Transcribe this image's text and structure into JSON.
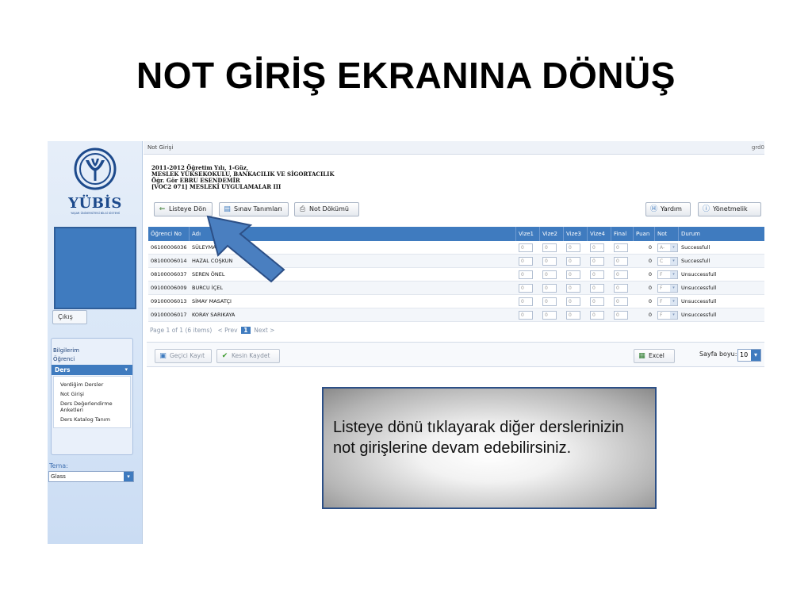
{
  "slide": {
    "title": "NOT GİRİŞ EKRANINA DÖNÜŞ"
  },
  "sidebar": {
    "logo_text": "YÜBİS",
    "logo_subtext": "YAŞAR ÜNİVERSİTESİ BİLGİ SİSTEMİ",
    "logout_label": "Çıkış",
    "menu": {
      "items_top": [
        "Bilgilerim",
        "Öğrenci"
      ],
      "active_label": "Ders",
      "sub_items": [
        "Verdiğim Dersler",
        "Not Girişi",
        "Ders Değerlendirme Anketleri",
        "Ders Katalog Tanım"
      ]
    },
    "theme_label": "Tema:",
    "theme_value": "Glass"
  },
  "topbar": {
    "title": "Not Girişi",
    "user": "grd0"
  },
  "info": {
    "line1": "2011-2012 Öğretim Yılı, 1-Güz,",
    "line2": "MESLEK YÜKSEKOKULU, BANKACILIK VE SİGORTACILIK",
    "line3": "Öğr. Gör EBRU ESENDEMİR",
    "line4": "[VOC2 071] MESLEKİ UYGULAMALAR III"
  },
  "toolbar": {
    "back_label": "Listeye Dön",
    "exam_label": "Sınav Tanımları",
    "print_label": "Not Dökümü",
    "help_label": "Yardım",
    "admin_label": "Yönetmelik"
  },
  "table": {
    "columns": [
      "Öğrenci No",
      "Adı",
      "Vize1",
      "Vize2",
      "Vize3",
      "Vize4",
      "Final",
      "Puan",
      "Not",
      "Durum"
    ],
    "rows": [
      {
        "no": "06100006036",
        "name": "SÜLEYMAN G",
        "v1": "0",
        "v2": "0",
        "v3": "0",
        "v4": "0",
        "final": "0",
        "puan": "0",
        "not": "A-",
        "durum": "Successfull"
      },
      {
        "no": "08100006014",
        "name": "HAZAL COŞKUN",
        "v1": "0",
        "v2": "0",
        "v3": "0",
        "v4": "0",
        "final": "0",
        "puan": "0",
        "not": "C",
        "durum": "Successfull"
      },
      {
        "no": "08100006037",
        "name": "SEREN ÖNEL",
        "v1": "0",
        "v2": "0",
        "v3": "0",
        "v4": "0",
        "final": "0",
        "puan": "0",
        "not": "F",
        "durum": "Unsuccessfull"
      },
      {
        "no": "09100006009",
        "name": "BURCU İÇEL",
        "v1": "0",
        "v2": "0",
        "v3": "0",
        "v4": "0",
        "final": "0",
        "puan": "0",
        "not": "F",
        "durum": "Unsuccessfull"
      },
      {
        "no": "09100006013",
        "name": "SİMAY MASATÇI",
        "v1": "0",
        "v2": "0",
        "v3": "0",
        "v4": "0",
        "final": "0",
        "puan": "0",
        "not": "F",
        "durum": "Unsuccessfull"
      },
      {
        "no": "09100006017",
        "name": "KORAY SARIKAYA",
        "v1": "0",
        "v2": "0",
        "v3": "0",
        "v4": "0",
        "final": "0",
        "puan": "0",
        "not": "F",
        "durum": "Unsuccessfull"
      }
    ]
  },
  "pager": {
    "text": "Page 1 of 1 (6 items)",
    "prev": "< Prev",
    "current": "1",
    "next": "Next >"
  },
  "bottom": {
    "temp_save_label": "Geçici Kayıt",
    "final_save_label": "Kesin Kaydet",
    "excel_label": "Excel",
    "page_size_label": "Sayfa boyu:",
    "page_size_value": "10"
  },
  "callout": {
    "text": "Listeye dönü tıklayarak diğer derslerinizin not girişlerine devam edebilirsiniz."
  },
  "colors": {
    "accent": "#3f7bbf",
    "arrow": "#4a7fc0",
    "callout_border": "#2c4f86"
  },
  "icons": {
    "back": "arrow-left-icon",
    "exam": "document-icon",
    "print": "printer-icon",
    "help": "help-icon",
    "info": "info-icon",
    "save": "floppy-icon",
    "check": "check-icon",
    "excel": "excel-icon"
  }
}
